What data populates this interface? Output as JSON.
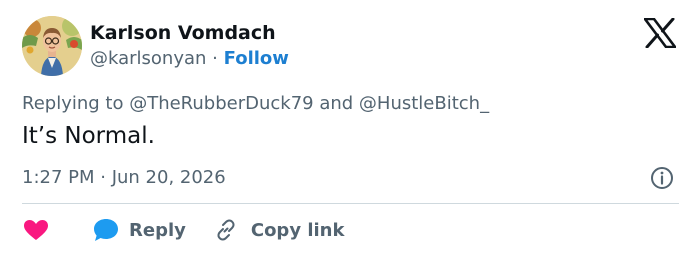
{
  "author": {
    "name": "Karlson Vomdach",
    "handle": "@karlsonyan",
    "separator": "·",
    "follow_label": "Follow",
    "avatar_icon": "avatar-portrait"
  },
  "brand": {
    "logo_icon": "x-logo-icon"
  },
  "tweet": {
    "replying_to": "Replying to @TheRubberDuck79 and @HustleBitch_",
    "text": "It’s Normal.",
    "timestamp": "1:27 PM · Jun 20, 2026"
  },
  "actions": {
    "like_icon": "heart-icon",
    "reply_icon": "speech-bubble-icon",
    "reply_label": "Reply",
    "copy_link_icon": "link-icon",
    "copy_link_label": "Copy link"
  },
  "colors": {
    "text_primary": "#0f1419",
    "text_secondary": "#536471",
    "link": "#1d7fd1",
    "like": "#f91880",
    "reply_icon": "#1d9bf0",
    "divider": "#cfd9de"
  }
}
